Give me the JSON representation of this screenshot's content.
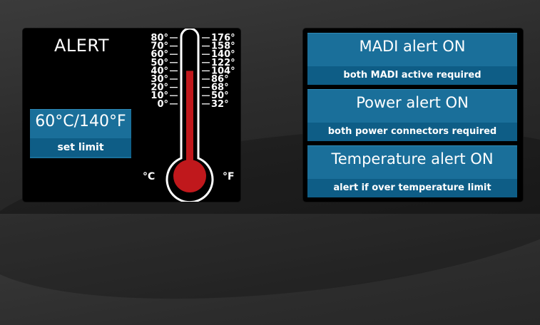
{
  "alert_panel": {
    "title": "ALERT",
    "limit_value": "60°C/140°F",
    "limit_label": "set limit",
    "thermometer": {
      "celsius_ticks": [
        "80°",
        "70°",
        "60°",
        "50°",
        "40°",
        "30°",
        "20°",
        "10°",
        "0°"
      ],
      "fahrenheit_ticks": [
        "176°",
        "158°",
        "140°",
        "122°",
        "104°",
        "86°",
        "68°",
        "50°",
        "32°"
      ],
      "celsius_unit": "°C",
      "fahrenheit_unit": "°F",
      "current_level_celsius": 40,
      "mercury_color": "#c0181c"
    }
  },
  "status_panel": {
    "cards": [
      {
        "title": "MADI alert ON",
        "subtitle": "both MADI active required"
      },
      {
        "title": "Power alert ON",
        "subtitle": "both power connectors required"
      },
      {
        "title": "Temperature alert ON",
        "subtitle": "alert if over temperature limit"
      }
    ]
  },
  "colors": {
    "card_blue": "#1a6f9a",
    "card_blue_dark": "#0e5d86",
    "panel_bg": "#000000"
  }
}
